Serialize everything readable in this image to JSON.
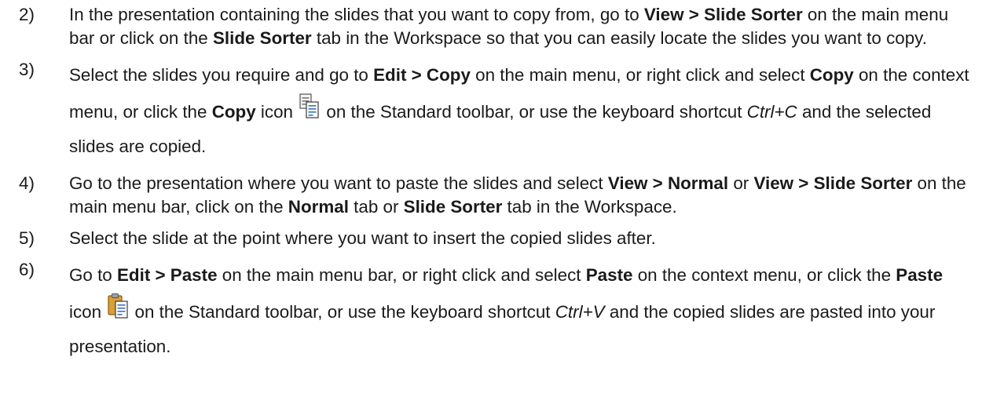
{
  "steps": [
    {
      "num": "2)",
      "parts": [
        {
          "t": "In the presentation containing the slides that you want to copy from, go to "
        },
        {
          "t": "View > Slide Sorter",
          "s": "b"
        },
        {
          "t": " on the main menu bar or click on the "
        },
        {
          "t": "Slide Sorter",
          "s": "b"
        },
        {
          "t": " tab in the Workspace so that you can easily locate the slides you want to copy."
        }
      ]
    },
    {
      "num": "3)",
      "parts": [
        {
          "t": "Select the slides you require and go to "
        },
        {
          "t": "Edit > Copy",
          "s": "b"
        },
        {
          "t": " on the main menu, or right click and select "
        },
        {
          "t": "Copy",
          "s": "b"
        },
        {
          "t": " on the context menu, or click the "
        },
        {
          "t": "Copy",
          "s": "b"
        },
        {
          "t": " icon "
        },
        {
          "icon": "copy-icon"
        },
        {
          "t": " on the Standard toolbar, or use the keyboard shortcut "
        },
        {
          "t": "Ctrl+C",
          "s": "i"
        },
        {
          "t": " and the selected slides are copied."
        }
      ]
    },
    {
      "num": "4)",
      "parts": [
        {
          "t": "Go to the presentation where you want to paste the slides and select "
        },
        {
          "t": "View > Normal",
          "s": "b"
        },
        {
          "t": " or "
        },
        {
          "t": "View > Slide Sorter",
          "s": "b"
        },
        {
          "t": " on the main menu bar, click on the "
        },
        {
          "t": "Normal",
          "s": "b"
        },
        {
          "t": " tab or "
        },
        {
          "t": "Slide Sorter",
          "s": "b"
        },
        {
          "t": " tab in the Workspace."
        }
      ]
    },
    {
      "num": "5)",
      "parts": [
        {
          "t": "Select the slide at the point where you want to insert the copied slides after."
        }
      ]
    },
    {
      "num": "6)",
      "parts": [
        {
          "t": "Go to "
        },
        {
          "t": "Edit > Paste",
          "s": "b"
        },
        {
          "t": " on the main menu bar, or right click and select "
        },
        {
          "t": "Paste",
          "s": "b"
        },
        {
          "t": " on the context menu, or click the "
        },
        {
          "t": "Paste",
          "s": "b"
        },
        {
          "t": " icon "
        },
        {
          "icon": "paste-icon"
        },
        {
          "t": " on the Standard toolbar, or use the keyboard shortcut "
        },
        {
          "t": "Ctrl+V",
          "s": "i"
        },
        {
          "t": " and the copied slides are pasted into your presentation."
        }
      ]
    }
  ]
}
